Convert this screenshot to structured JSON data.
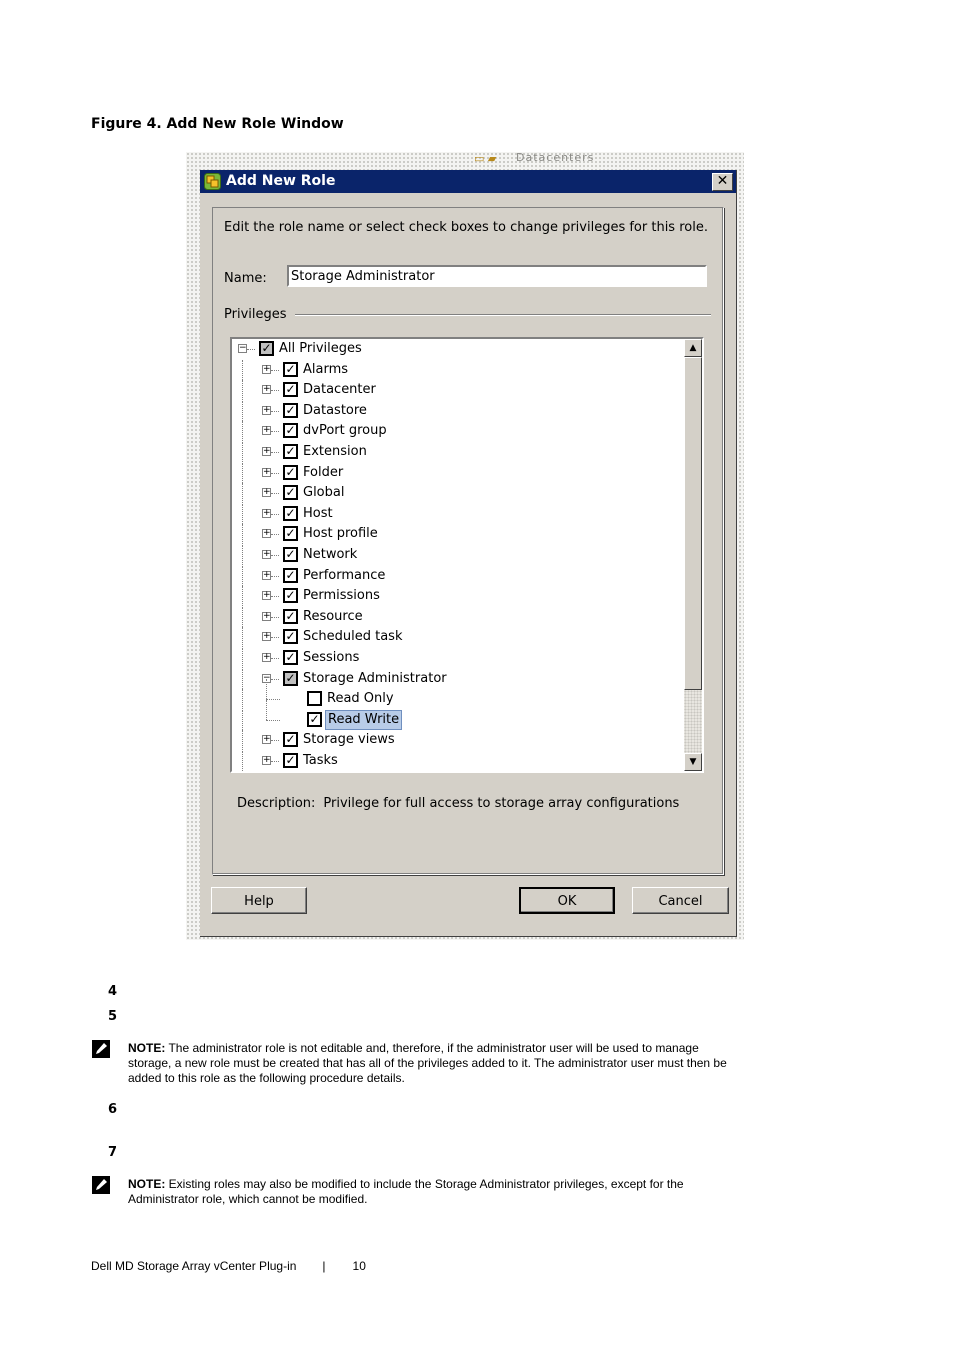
{
  "figure_caption": "Figure 4.  Add New Role Window",
  "background_window": {
    "breadcrumb_text": "Datacenters"
  },
  "dialog": {
    "title": "Add New Role",
    "icon": "vsphere-role-icon",
    "close_label": "✕",
    "intro": "Edit the role name or select check boxes to change privileges for this role.",
    "name_label": "Name:",
    "name_value": "Storage Administrator",
    "privileges_label": "Privileges",
    "tree": [
      {
        "label": "All Privileges",
        "level": 0,
        "expander": "minus",
        "checked": true,
        "partial": true
      },
      {
        "label": "Alarms",
        "level": 1,
        "expander": "plus",
        "checked": true
      },
      {
        "label": "Datacenter",
        "level": 1,
        "expander": "plus",
        "checked": true
      },
      {
        "label": "Datastore",
        "level": 1,
        "expander": "plus",
        "checked": true
      },
      {
        "label": "dvPort group",
        "level": 1,
        "expander": "plus",
        "checked": true
      },
      {
        "label": "Extension",
        "level": 1,
        "expander": "plus",
        "checked": true
      },
      {
        "label": "Folder",
        "level": 1,
        "expander": "plus",
        "checked": true
      },
      {
        "label": "Global",
        "level": 1,
        "expander": "plus",
        "checked": true
      },
      {
        "label": "Host",
        "level": 1,
        "expander": "plus",
        "checked": true
      },
      {
        "label": "Host profile",
        "level": 1,
        "expander": "plus",
        "checked": true
      },
      {
        "label": "Network",
        "level": 1,
        "expander": "plus",
        "checked": true
      },
      {
        "label": "Performance",
        "level": 1,
        "expander": "plus",
        "checked": true
      },
      {
        "label": "Permissions",
        "level": 1,
        "expander": "plus",
        "checked": true
      },
      {
        "label": "Resource",
        "level": 1,
        "expander": "plus",
        "checked": true
      },
      {
        "label": "Scheduled task",
        "level": 1,
        "expander": "plus",
        "checked": true
      },
      {
        "label": "Sessions",
        "level": 1,
        "expander": "plus",
        "checked": true
      },
      {
        "label": "Storage Administrator",
        "level": 1,
        "expander": "minus",
        "checked": true,
        "partial": true
      },
      {
        "label": "Read Only",
        "level": 2,
        "expander": "none",
        "checked": false
      },
      {
        "label": "Read Write",
        "level": 2,
        "expander": "none",
        "checked": true,
        "selected": true
      },
      {
        "label": "Storage views",
        "level": 1,
        "expander": "plus",
        "checked": true
      },
      {
        "label": "Tasks",
        "level": 1,
        "expander": "plus",
        "checked": true
      },
      {
        "label": "",
        "level": 1,
        "expander": "plus",
        "checked": true
      }
    ],
    "scroll_position_fraction": 0.0,
    "description_label": "Description:",
    "description_value": "Privilege for full access to storage array configurations",
    "buttons": {
      "help": "Help",
      "ok": "OK",
      "cancel": "Cancel"
    },
    "colors": {
      "titlebar": "#0a246a",
      "face": "#d4d0c8",
      "selection": "#b8cce8"
    }
  },
  "steps": [
    {
      "number": "4"
    },
    {
      "number": "5"
    },
    {
      "number": "6"
    },
    {
      "number": "7"
    }
  ],
  "notes": [
    {
      "label": "NOTE:",
      "text": " The administrator role is not editable and, therefore, if the administrator user will be used to manage storage, a new role must be created that has all of the privileges added to it. The administrator user must then be added to this role as the following procedure details."
    },
    {
      "label": "NOTE:",
      "text": " Existing roles may also be modified to include the Storage Administrator privileges, except for the Administrator role, which cannot be modified."
    }
  ],
  "footer": {
    "doc_title": "Dell MD Storage Array vCenter Plug-in",
    "separator": "|",
    "page_number": "10"
  }
}
